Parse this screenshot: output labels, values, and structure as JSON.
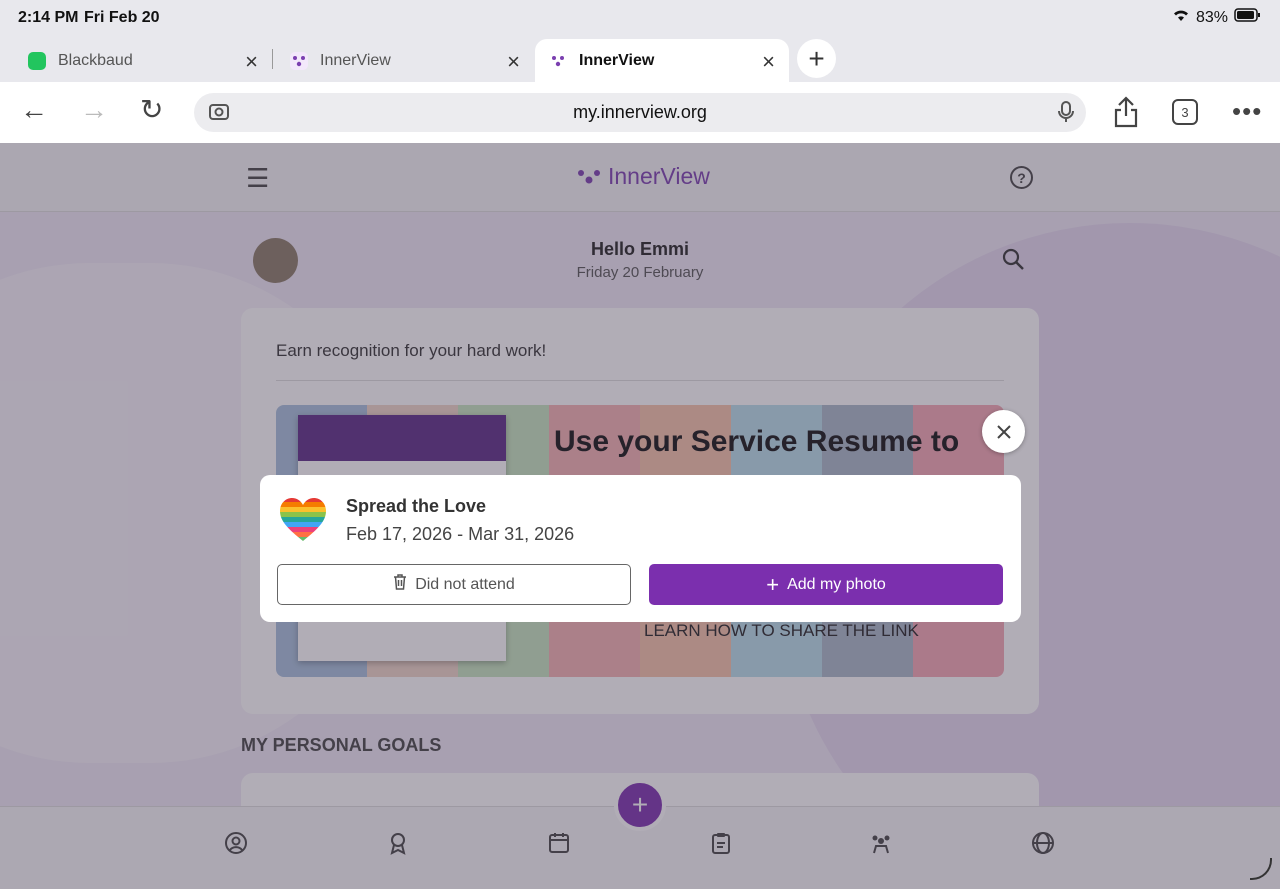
{
  "status": {
    "time": "2:14 PM",
    "date": "Fri Feb 20",
    "battery": "83%"
  },
  "tabs": [
    {
      "label": "Blackbaud",
      "fav_color": "#22c55e"
    },
    {
      "label": "InnerView",
      "fav_color": "#7b3fb0"
    },
    {
      "label": "InnerView",
      "fav_color": "#7b3fb0"
    }
  ],
  "toolbar": {
    "url": "my.innerview.org",
    "tab_count": "3"
  },
  "app": {
    "logo_text": "InnerView",
    "greeting": "Hello Emmi",
    "subdate": "Friday 20 February",
    "card_title": "Earn recognition for your hard work!",
    "banner_headline": "Use your Service Resume to",
    "banner_learn": "LEARN HOW TO SHARE THE LINK",
    "section_title": "MY PERSONAL GOALS"
  },
  "modal": {
    "title": "Spread the Love",
    "dates": "Feb 17, 2026 - Mar 31, 2026",
    "decline_label": "Did not attend",
    "accept_label": "Add my photo"
  },
  "colors": {
    "accent": "#7b2fae"
  }
}
